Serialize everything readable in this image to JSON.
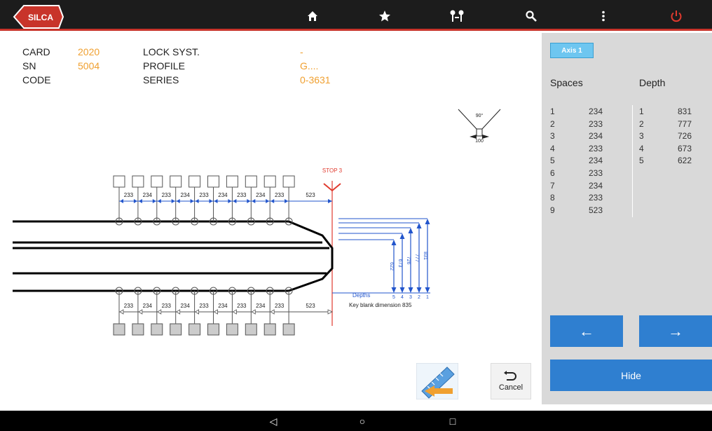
{
  "brand": {
    "logo_text": "SILCA"
  },
  "topbar": {
    "accent": "#c8342a",
    "icons": [
      "home-icon",
      "star-icon",
      "key-cut-icon",
      "search-icon",
      "more-icon",
      "power-icon"
    ]
  },
  "info": {
    "card_label": "CARD",
    "card_value": "2020",
    "sn_label": "SN",
    "sn_value": "5004",
    "code_label": "CODE",
    "code_value": "",
    "lock_label": "LOCK SYST.",
    "lock_value": "-",
    "profile_label": "PROFILE",
    "profile_value": "G....",
    "series_label": "SERIES",
    "series_value": "0-3631"
  },
  "drawing": {
    "angle_top": "90°",
    "angle_bottom": "100",
    "stop_label": "STOP 3",
    "spacing_top": [
      "233",
      "234",
      "233",
      "234",
      "233",
      "234",
      "233",
      "234",
      "233"
    ],
    "last_space_top": "523",
    "spacing_bottom": [
      "233",
      "234",
      "233",
      "234",
      "233",
      "234",
      "233",
      "234",
      "233"
    ],
    "last_space_bottom": "523",
    "depth_values": [
      "622",
      "673",
      "726",
      "777",
      "831"
    ],
    "depth_numbers": [
      "5",
      "4",
      "3",
      "2",
      "1"
    ],
    "depths_label": "Depths",
    "blank_dimension_label": "Key blank dimension 835"
  },
  "panel": {
    "axis_button": "Axis 1",
    "spaces_header": "Spaces",
    "depth_header": "Depth",
    "spaces": [
      {
        "n": "1",
        "v": "234"
      },
      {
        "n": "2",
        "v": "233"
      },
      {
        "n": "3",
        "v": "234"
      },
      {
        "n": "4",
        "v": "233"
      },
      {
        "n": "5",
        "v": "234"
      },
      {
        "n": "6",
        "v": "233"
      },
      {
        "n": "7",
        "v": "234"
      },
      {
        "n": "8",
        "v": "233"
      },
      {
        "n": "9",
        "v": "523"
      }
    ],
    "depths": [
      {
        "n": "1",
        "v": "831"
      },
      {
        "n": "2",
        "v": "777"
      },
      {
        "n": "3",
        "v": "726"
      },
      {
        "n": "4",
        "v": "673"
      },
      {
        "n": "5",
        "v": "622"
      }
    ],
    "prev_label": "←",
    "next_label": "→",
    "hide_label": "Hide"
  },
  "actions": {
    "cancel_label": "Cancel"
  },
  "navbar": {
    "back": "◁",
    "home": "○",
    "recents": "□"
  }
}
